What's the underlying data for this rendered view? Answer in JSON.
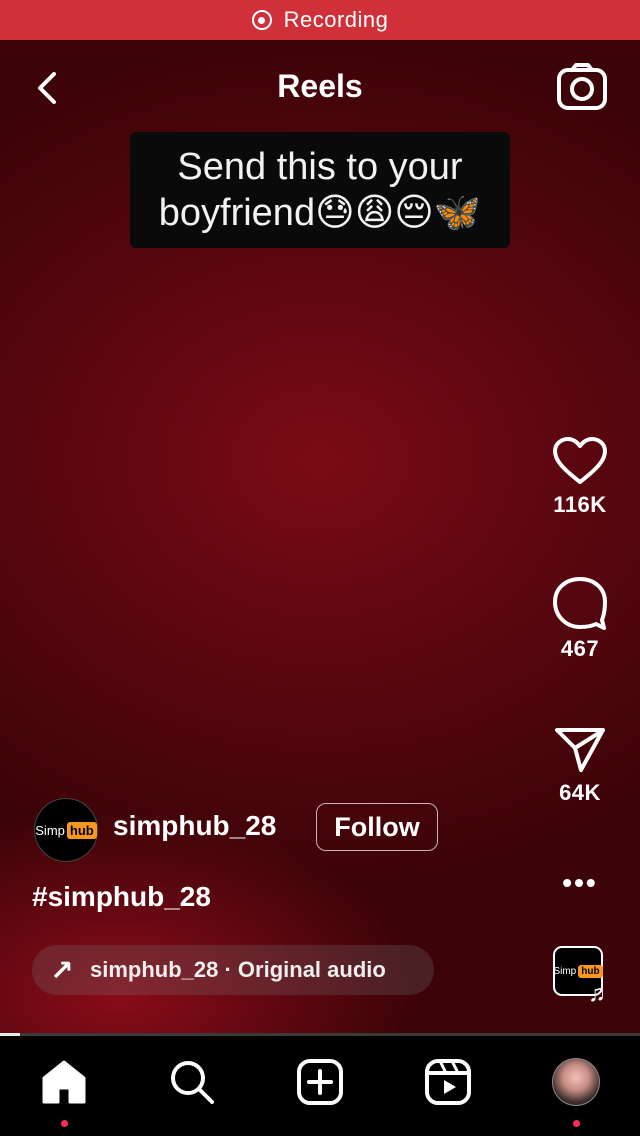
{
  "status_bar": {
    "recording_label": "Recording"
  },
  "header": {
    "title": "Reels"
  },
  "video": {
    "caption_line1": "Send this to your",
    "caption_line2": "boyfriend😓😩😔🦋"
  },
  "actions": {
    "likes": "116K",
    "comments": "467",
    "shares": "64K",
    "more": "•••"
  },
  "post": {
    "avatar_text": "Simp",
    "avatar_logo": "hub",
    "username": "simphub_28",
    "follow_label": "Follow",
    "hashtag": "#simphub_28",
    "audio_arrow": "↗",
    "audio_text": "simphub_28 · Original audio",
    "audio_thumb_text": "Simp",
    "audio_thumb_logo": "hub",
    "music_note": "♫"
  },
  "colors": {
    "recording_bar": "#d0303a",
    "notification_dot": "#ff2d55"
  }
}
